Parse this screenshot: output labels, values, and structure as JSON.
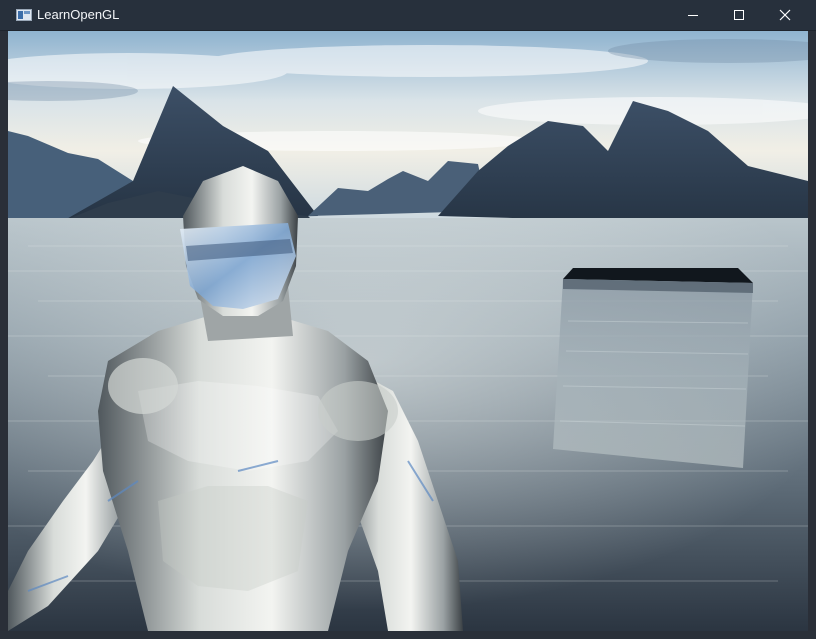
{
  "window": {
    "title": "LearnOpenGL",
    "icons": {
      "app": "app-window-icon",
      "minimize": "minimize-icon",
      "maximize": "maximize-icon",
      "close": "close-icon"
    },
    "colors": {
      "titlebar": "#27303c",
      "title_text": "#f3f5f8"
    }
  },
  "scene": {
    "description_keys": {
      "sky": "cloudy-sky-skybox",
      "mountains": "mountain-range",
      "water": "lake-water",
      "model": "reflective-nanosuit-model",
      "cube": "glass-cube"
    },
    "colors": {
      "sky_top": "#a8c3d8",
      "sky_horizon": "#eef0ea",
      "mountain": "#36485e",
      "water_light": "#c8d0d2",
      "water_dark": "#2e3946",
      "metal_light": "#e6e8e6",
      "metal_dark": "#3e4347"
    }
  }
}
